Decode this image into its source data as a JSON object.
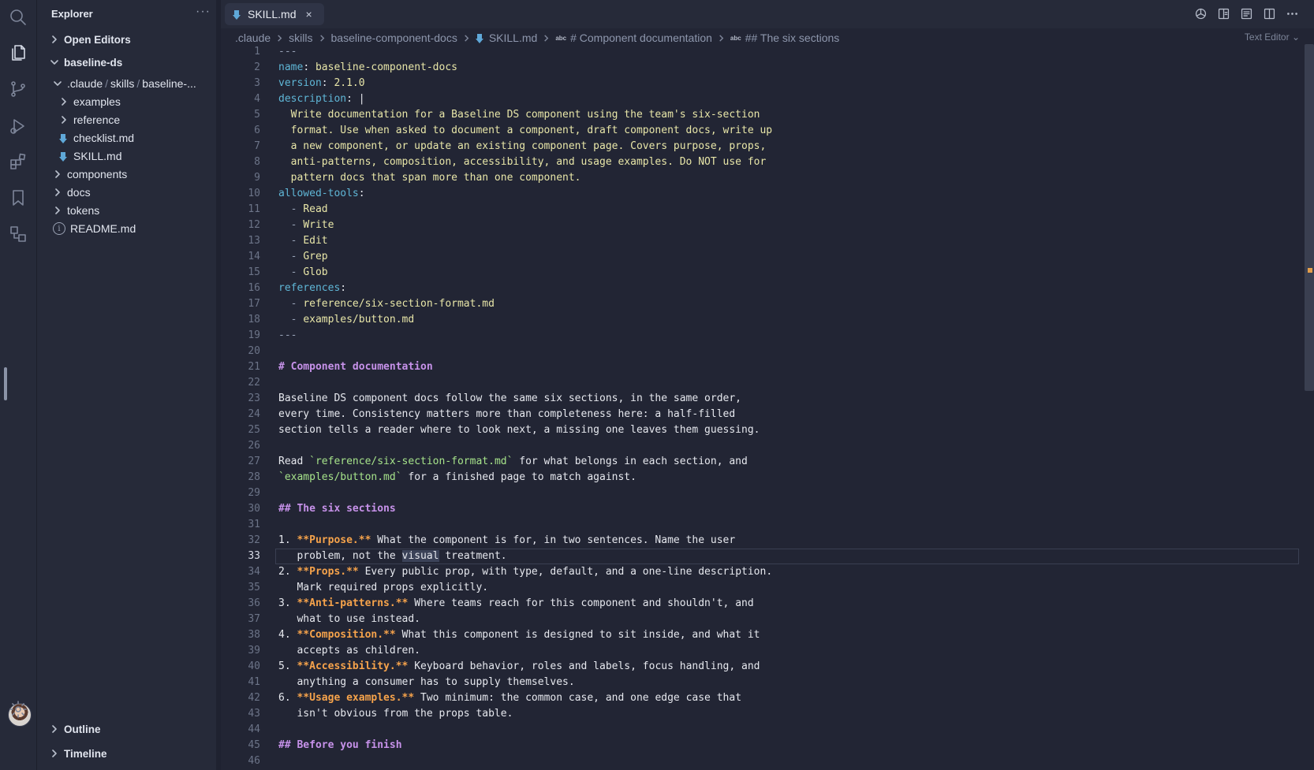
{
  "sidebar": {
    "title": "Explorer",
    "more": "···",
    "open_editors": "Open Editors",
    "workspace": "baseline-ds",
    "path": {
      "p1": ".claude",
      "p2": "skills",
      "p3": "baseline-..."
    },
    "items": [
      {
        "label": "examples"
      },
      {
        "label": "reference"
      },
      {
        "label": "checklist.md"
      },
      {
        "label": "SKILL.md"
      },
      {
        "label": "components"
      },
      {
        "label": "docs"
      },
      {
        "label": "tokens"
      },
      {
        "label": "README.md"
      }
    ],
    "outline": "Outline",
    "timeline": "Timeline"
  },
  "tab": {
    "label": "SKILL.md",
    "close": "×"
  },
  "breadcrumb": {
    "c1": ".claude",
    "c2": "skills",
    "c3": "baseline-component-docs",
    "c4": "SKILL.md",
    "abc": "abc",
    "c5": "# Component documentation",
    "c6": "## The six sections"
  },
  "editor_mode": "Text Editor",
  "code": {
    "l1": "---",
    "l2k": "name",
    "l2v": "baseline-component-docs",
    "l3k": "version",
    "l3v": "2.1.0",
    "l4k": "description",
    "l4v": "|",
    "l5": "  Write documentation for a Baseline DS component using the team's six-section",
    "l6": "  format. Use when asked to document a component, draft component docs, write up",
    "l7": "  a new component, or update an existing component page. Covers purpose, props,",
    "l8": "  anti-patterns, composition, accessibility, and usage examples. Do NOT use for",
    "l9": "  pattern docs that span more than one component.",
    "l10k": "allowed-tools",
    "l11": "Read",
    "l12": "Write",
    "l13": "Edit",
    "l14": "Grep",
    "l15": "Glob",
    "l16k": "references",
    "l17": "reference/six-section-format.md",
    "l18": "examples/button.md",
    "l19": "---",
    "l21": "# Component documentation",
    "l23": "Baseline DS component docs follow the same six sections, in the same order,",
    "l24": "every time. Consistency matters more than completeness here: a half-filled",
    "l25": "section tells a reader where to look next, a missing one leaves them guessing.",
    "l27a": "Read ",
    "l27b": "`reference/six-section-format.md`",
    "l27c": " for what belongs in each section, and",
    "l28a": "`examples/button.md`",
    "l28b": " for a finished page to match against.",
    "l30": "## The six sections",
    "l32n": "1. ",
    "l32b": "**Purpose.**",
    "l32t": " What the component is for, in two sentences. Name the user",
    "l33a": "   problem, not the ",
    "l33s": "visual",
    "l33b": " treatment.",
    "l34n": "2. ",
    "l34b": "**Props.**",
    "l34t": " Every public prop, with type, default, and a one-line description.",
    "l35": "   Mark required props explicitly.",
    "l36n": "3. ",
    "l36b": "**Anti-patterns.**",
    "l36t": " Where teams reach for this component and shouldn't, and",
    "l37": "   what to use instead.",
    "l38n": "4. ",
    "l38b": "**Composition.**",
    "l38t": " What this component is designed to sit inside, and what it",
    "l39": "   accepts as children.",
    "l40n": "5. ",
    "l40b": "**Accessibility.**",
    "l40t": " Keyboard behavior, roles and labels, focus handling, and",
    "l41": "   anything a consumer has to supply themselves.",
    "l42n": "6. ",
    "l42b": "**Usage examples.**",
    "l42t": " Two minimum: the common case, and one edge case that",
    "l43": "   isn't obvious from the props table.",
    "l45": "## Before you finish"
  },
  "line_numbers": [
    "1",
    "2",
    "3",
    "4",
    "5",
    "6",
    "7",
    "8",
    "9",
    "10",
    "11",
    "12",
    "13",
    "14",
    "15",
    "16",
    "17",
    "18",
    "19",
    "20",
    "21",
    "22",
    "23",
    "24",
    "25",
    "26",
    "27",
    "28",
    "29",
    "30",
    "31",
    "32",
    "33",
    "34",
    "35",
    "36",
    "37",
    "38",
    "39",
    "40",
    "41",
    "42",
    "43",
    "44",
    "45",
    "46"
  ],
  "colors": {
    "background": "#222534",
    "sidebar": "#262a39",
    "heading": "#c792ea",
    "bold": "#f6a34b",
    "key": "#5fb6d6",
    "code_span": "#a6e38a"
  }
}
